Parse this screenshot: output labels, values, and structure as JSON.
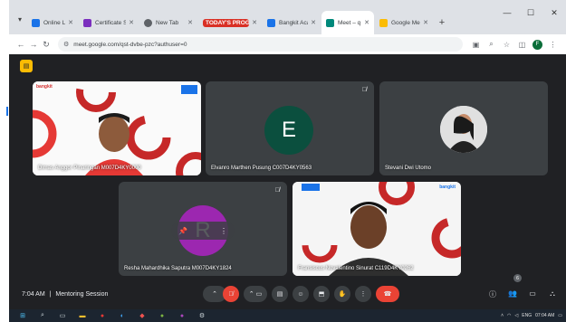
{
  "browser": {
    "tabs": [
      {
        "label": "Online Learn",
        "favicon_color": "#1a73e8"
      },
      {
        "label": "Certificate S",
        "favicon_color": "#7b2fbe"
      },
      {
        "label": "New Tab",
        "favicon_color": "#5f6368"
      },
      {
        "label": "TODAY'S PROGRAM",
        "favicon_color": "#d93025"
      },
      {
        "label": "Bangkit Acad",
        "favicon_color": "#1a73e8"
      },
      {
        "label": "Meet – q",
        "favicon_color": "#00897b"
      },
      {
        "label": "Google Meet",
        "favicon_color": "#fbbc04"
      }
    ],
    "active_tab_index": 5,
    "url": "meet.google.com/qst-dvbe-pzc?authuser=0",
    "profile_initial": "F"
  },
  "meet": {
    "time": "7:04 AM",
    "separator": "|",
    "meeting_title": "Mentoring Session",
    "participants": [
      {
        "name": "Dimas Anggor Pinaringan M007D4KY0000",
        "type": "camera"
      },
      {
        "name": "Elvanro Marthen Pusung C007D4KY0563",
        "type": "initial",
        "initial": "E",
        "avatar_color": "#0b4f3e"
      },
      {
        "name": "Stevani Dwi Utomo",
        "type": "photo"
      },
      {
        "name": "Resha Mahardhika Saputra M007D4KY1824",
        "type": "initial",
        "initial": "R",
        "avatar_color": "#9c27b0"
      },
      {
        "name": "Fransiscus Novalentino Sinurat C119D4KY0262",
        "type": "camera"
      }
    ],
    "camera_brand": "bangkit",
    "people_count": "6"
  },
  "taskbar": {
    "clock_time": "07:04 AM",
    "clock_date": "",
    "lang": "ENG"
  }
}
